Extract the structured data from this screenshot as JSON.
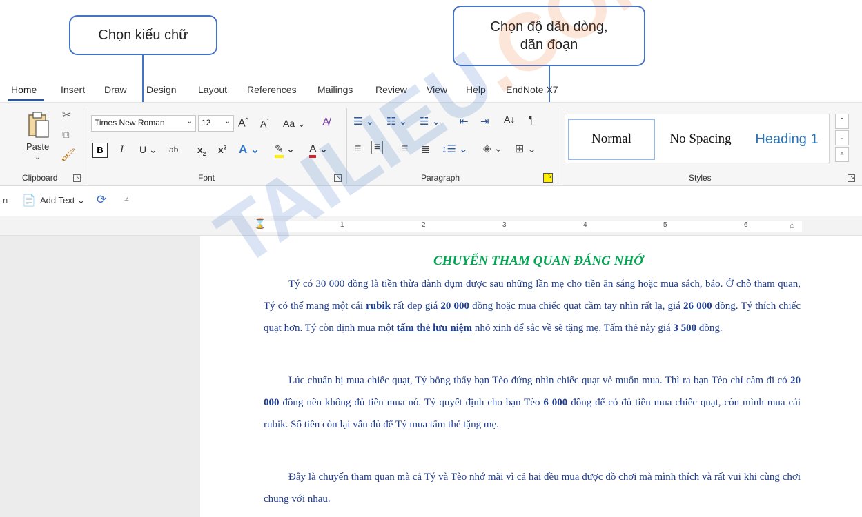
{
  "callouts": {
    "font_style": "Chọn kiểu chữ",
    "line_spacing_line1": "Chọn độ dãn dòng,",
    "line_spacing_line2": "dãn đoạn"
  },
  "tabs": [
    "Home",
    "Insert",
    "Draw",
    "Design",
    "Layout",
    "References",
    "Mailings",
    "Review",
    "View",
    "Help",
    "EndNote X7"
  ],
  "clipboard": {
    "paste_label": "Paste",
    "group_label": "Clipboard"
  },
  "font": {
    "font_name": "Times New Roman",
    "font_size": "12",
    "grow": "A",
    "shrink": "A",
    "change_case": "Aa",
    "bold": "B",
    "italic": "I",
    "underline": "U",
    "strike": "ab",
    "subscript": "x",
    "superscript": "x",
    "group_label": "Font"
  },
  "paragraph": {
    "group_label": "Paragraph"
  },
  "styles": {
    "items": [
      "Normal",
      "No Spacing",
      "Heading 1"
    ],
    "group_label": "Styles"
  },
  "quick_access": {
    "add_text_label": "Add Text"
  },
  "ruler": {
    "numbers": [
      "1",
      "2",
      "3",
      "4",
      "5",
      "6"
    ]
  },
  "watermark": {
    "text_blue": "TAILIEU",
    "text_orange": ".COM"
  },
  "document": {
    "title": "CHUYẾN THAM QUAN ĐÁNG NHỚ",
    "p1": [
      {
        "t": "Tý có 30 000 đồng là tiền thừa dành dụm được sau những lần mẹ cho tiền ăn sáng hoặc mua sách, báo. Ở chỗ tham quan, Tý có thể mang một cái ",
        "s": ""
      },
      {
        "t": "rubik",
        "s": "bu"
      },
      {
        "t": " rất đẹp giá ",
        "s": ""
      },
      {
        "t": "20 000",
        "s": "bu"
      },
      {
        "t": " đồng hoặc mua  chiếc quạt cầm tay nhìn rất lạ, giá ",
        "s": ""
      },
      {
        "t": "26 000",
        "s": "bu"
      },
      {
        "t": " đồng. Tý thích chiếc quạt hơn. Tý còn định mua một ",
        "s": ""
      },
      {
        "t": "tấm thẻ lưu niệm",
        "s": "bu"
      },
      {
        "t": " nhỏ xinh để sắc về sẽ tặng mẹ. Tấm thẻ này giá ",
        "s": ""
      },
      {
        "t": "3 500",
        "s": "bu"
      },
      {
        "t": " đồng.",
        "s": ""
      }
    ],
    "p2": [
      {
        "t": "Lúc chuẩn bị mua chiếc quạt, Tý bỗng thấy bạn Tèo đứng nhìn chiếc quạt vẻ muốn mua. Thì ra bạn Tèo chỉ cầm đi có ",
        "s": ""
      },
      {
        "t": "20 000",
        "s": "b"
      },
      {
        "t": " đồng nên không đủ tiền mua nó. Tý quyết định cho bạn Tèo ",
        "s": ""
      },
      {
        "t": "6 000",
        "s": "b"
      },
      {
        "t": " đồng để có đủ tiền mua chiếc quạt, còn mình mua cái rubik. Số tiền còn lại vẫn đủ để Tý mua tấm thẻ tặng mẹ.",
        "s": ""
      }
    ],
    "p3": [
      {
        "t": "Đây là chuyến tham quan mà cả Tý và Tèo nhớ mãi vì cả hai đều mua được đồ chơi mà mình thích và rất vui khi cùng chơi chung với nhau.",
        "s": ""
      }
    ]
  }
}
